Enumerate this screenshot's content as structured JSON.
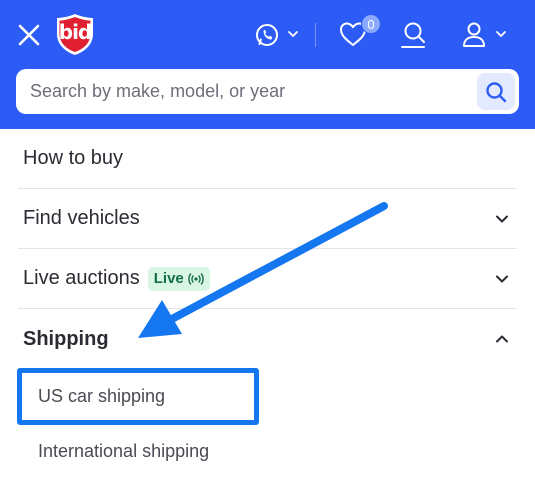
{
  "header": {
    "logo_text": "bid",
    "favorites_count": "0",
    "colors": {
      "header_bg": "#2c5cf5",
      "logo_red": "#e02030"
    },
    "icons": [
      "close-icon",
      "whatsapp-icon",
      "chevron-down-icon",
      "heart-icon",
      "search-user-icon",
      "user-icon"
    ]
  },
  "search": {
    "placeholder": "Search by make, model, or year",
    "value": ""
  },
  "menu": {
    "items": [
      {
        "label": "How to buy"
      },
      {
        "label": "Find vehicles"
      },
      {
        "label": "Live auctions",
        "badge": "Live"
      },
      {
        "label": "Shipping"
      }
    ],
    "shipping_subitems": [
      {
        "label": "US car shipping"
      },
      {
        "label": "International shipping"
      }
    ]
  },
  "annotation": {
    "color": "#1577f0"
  }
}
